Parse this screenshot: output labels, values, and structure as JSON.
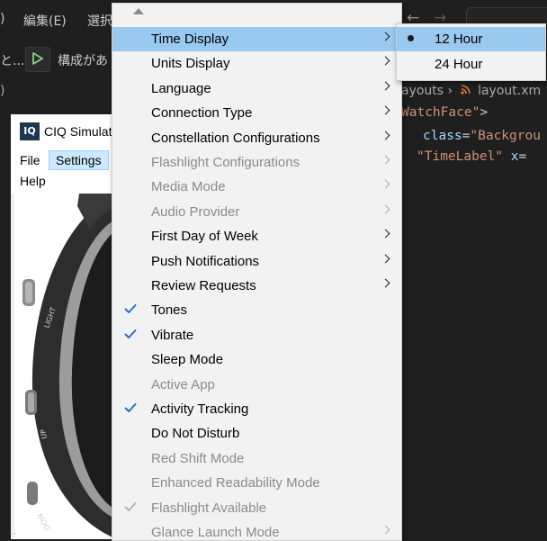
{
  "vscode": {
    "menu_items": [
      ")",
      "編集(E)",
      "選択"
    ],
    "back_arrow": "←",
    "forward_arrow": "→",
    "run_ellipsis": "と...",
    "run_config": "構成があ",
    "breadcrumb_left": "ayouts",
    "breadcrumb_sep": "›",
    "breadcrumb_file": "layout.xm",
    "misc": ")",
    "code": {
      "line1_str": "WatchFace\"",
      "line1_end": ">",
      "line2_attr": "class",
      "line2_eq": "=",
      "line2_str": "\"Backgrou",
      "line3_str": "\"TimeLabel\"",
      "line3_attr": "x",
      "line3_eq": "="
    }
  },
  "simulator": {
    "logo": "IQ",
    "title": "CIQ Simulat",
    "menu": {
      "file": "File",
      "settings": "Settings",
      "help": "Help"
    }
  },
  "settings_menu": {
    "items": [
      {
        "label": "Time Display",
        "submenu": true,
        "enabled": true,
        "highlighted": true
      },
      {
        "label": "Units Display",
        "submenu": true,
        "enabled": true
      },
      {
        "label": "Language",
        "submenu": true,
        "enabled": true
      },
      {
        "label": "Connection Type",
        "submenu": true,
        "enabled": true
      },
      {
        "label": "Constellation Configurations",
        "submenu": true,
        "enabled": true
      },
      {
        "label": "Flashlight Configurations",
        "submenu": true,
        "enabled": false
      },
      {
        "label": "Media Mode",
        "submenu": true,
        "enabled": false
      },
      {
        "label": "Audio Provider",
        "submenu": true,
        "enabled": false
      },
      {
        "label": "First Day of Week",
        "submenu": true,
        "enabled": true
      },
      {
        "label": "Push Notifications",
        "submenu": true,
        "enabled": true
      },
      {
        "label": "Review Requests",
        "submenu": true,
        "enabled": true
      },
      {
        "label": "Tones",
        "enabled": true,
        "checked": true
      },
      {
        "label": "Vibrate",
        "enabled": true,
        "checked": true
      },
      {
        "label": "Sleep Mode",
        "enabled": true
      },
      {
        "label": "Active App",
        "enabled": false
      },
      {
        "label": "Activity Tracking",
        "enabled": true,
        "checked": true
      },
      {
        "label": "Do Not Disturb",
        "enabled": true
      },
      {
        "label": "Red Shift Mode",
        "enabled": false
      },
      {
        "label": "Enhanced Readability Mode",
        "enabled": false
      },
      {
        "label": "Flashlight Available",
        "enabled": false,
        "checked": true
      },
      {
        "label": "Glance Launch Mode",
        "submenu": true,
        "enabled": false
      }
    ]
  },
  "time_display_submenu": {
    "items": [
      {
        "label": "12 Hour",
        "selected": true,
        "highlighted": true
      },
      {
        "label": "24 Hour",
        "selected": false
      }
    ]
  },
  "watch_bezel_labels": [
    "LIGHT",
    "UP",
    "DOW",
    "ﾁ"
  ],
  "colors": {
    "menu_bg": "#f2f2f2",
    "menu_highlight": "#99c9ef",
    "check_enabled": "#1a6fc4",
    "check_disabled": "#b5b5b5",
    "vscode_bg": "#1f1f1f",
    "code_string": "#ce9178",
    "code_attr": "#9cdcfe",
    "run_green": "#89d185"
  }
}
